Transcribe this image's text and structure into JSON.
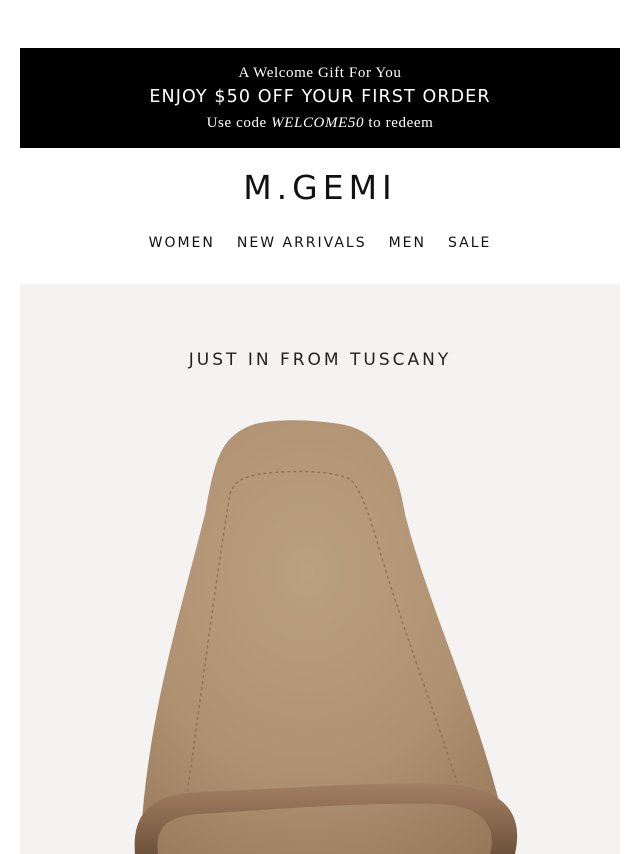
{
  "promo": {
    "gift_line": "A Welcome Gift For You",
    "offer_line": "ENJOY $50 OFF YOUR FIRST ORDER",
    "code_prefix": "Use code ",
    "code": "WELCOME50",
    "code_suffix": " to redeem"
  },
  "brand": {
    "logo": "M.GEMI"
  },
  "nav": {
    "items": [
      {
        "label": "WOMEN"
      },
      {
        "label": "NEW ARRIVALS"
      },
      {
        "label": "MEN"
      },
      {
        "label": "SALE"
      }
    ]
  },
  "hero": {
    "headline": "JUST IN FROM TUSCANY",
    "image_name": "suede-loafer-closeup"
  },
  "colors": {
    "promo_bg": "#000000",
    "hero_bg": "#f4f3f1",
    "suede": "#b39676",
    "strap": "#8a6a4f"
  }
}
